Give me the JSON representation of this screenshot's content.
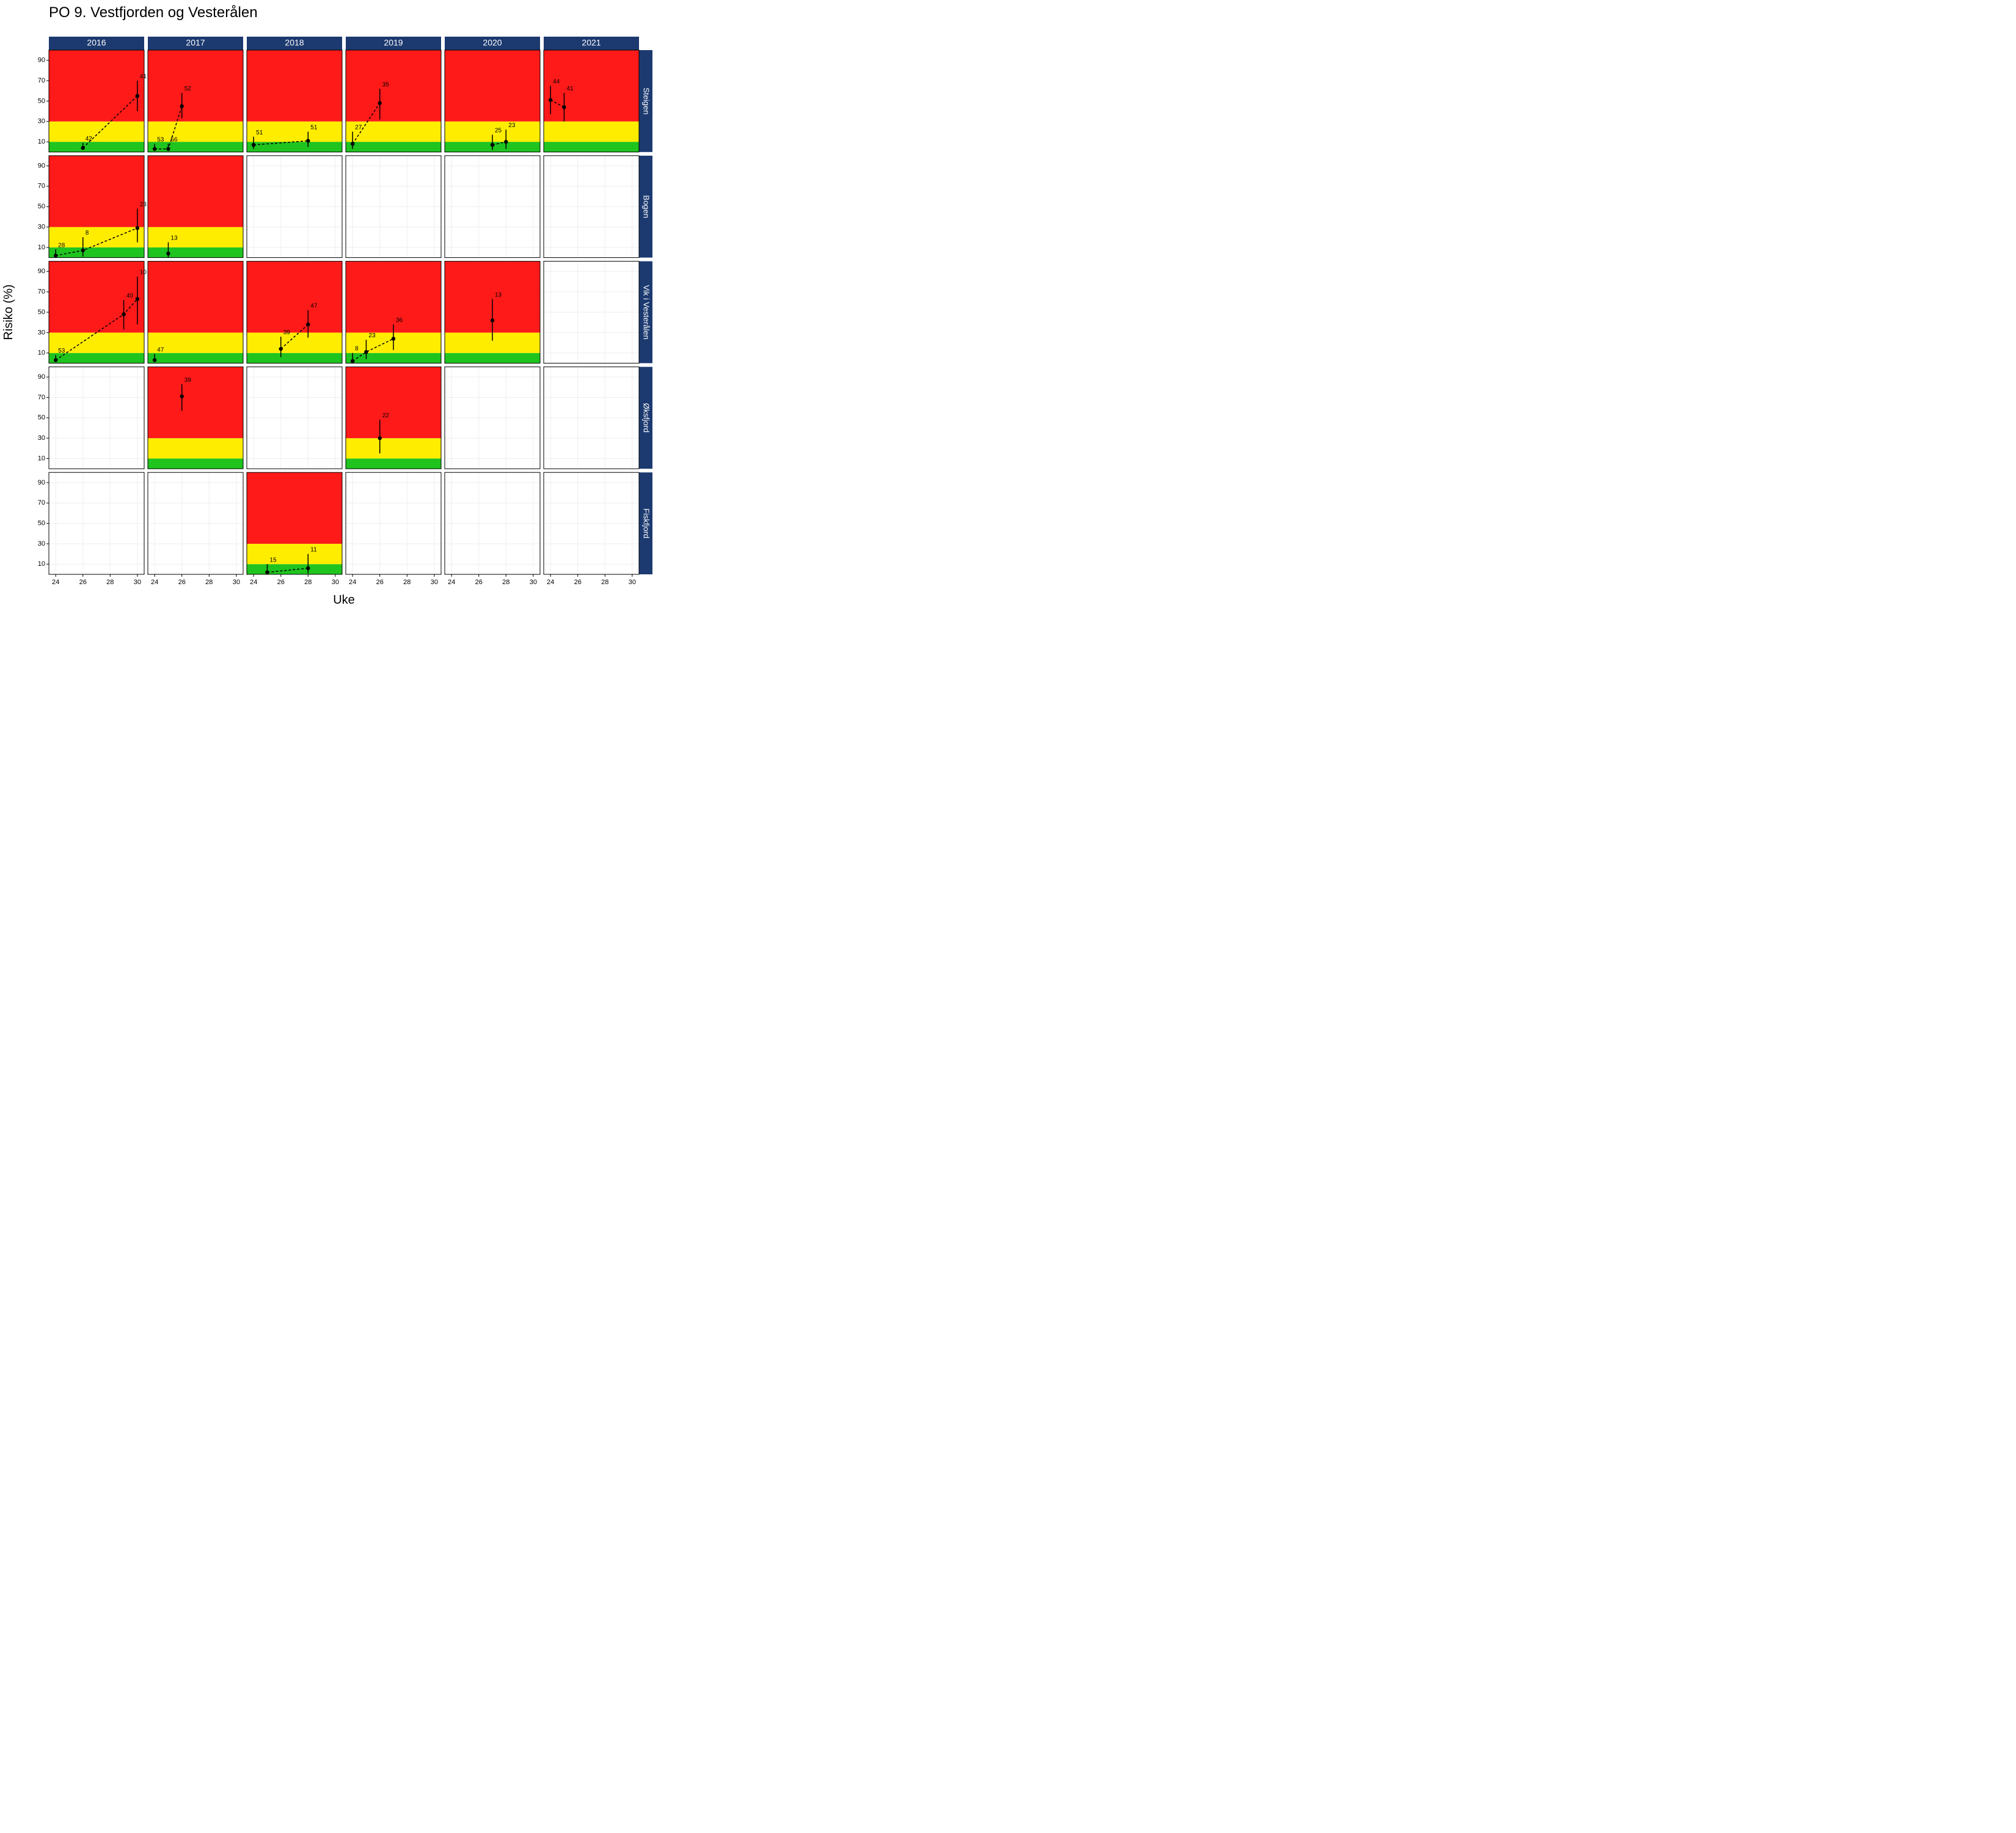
{
  "chart_data": {
    "type": "scatter",
    "title": "PO 9. Vestfjorden og Vesterålen",
    "xlabel": "Uke",
    "ylabel": "Risiko (%)",
    "xlim": [
      23.5,
      30.5
    ],
    "ylim": [
      0,
      100
    ],
    "x_ticks": [
      24,
      26,
      28,
      30
    ],
    "y_ticks": [
      10,
      30,
      50,
      70,
      90
    ],
    "zones": [
      {
        "from": 0,
        "to": 10,
        "color": "green"
      },
      {
        "from": 10,
        "to": 30,
        "color": "yellow"
      },
      {
        "from": 30,
        "to": 100,
        "color": "red"
      }
    ],
    "cols": [
      "2016",
      "2017",
      "2018",
      "2019",
      "2020",
      "2021"
    ],
    "rows": [
      "Steigen",
      "Bogen",
      "Vik i Vesterålen",
      "Øksfjord",
      "Fiskfjord"
    ],
    "panels": [
      {
        "r": 0,
        "c": 0,
        "data": true,
        "pts": [
          {
            "x": 26,
            "y": 4,
            "lo": 2,
            "hi": 9,
            "n": 42
          },
          {
            "x": 30,
            "y": 55,
            "lo": 40,
            "hi": 70,
            "n": 41
          }
        ]
      },
      {
        "r": 0,
        "c": 1,
        "data": true,
        "pts": [
          {
            "x": 24,
            "y": 3,
            "lo": 1,
            "hi": 8,
            "n": 53
          },
          {
            "x": 25,
            "y": 3,
            "lo": 1,
            "hi": 8,
            "n": 56
          },
          {
            "x": 26,
            "y": 45,
            "lo": 33,
            "hi": 58,
            "n": 52
          }
        ]
      },
      {
        "r": 0,
        "c": 2,
        "data": true,
        "pts": [
          {
            "x": 24,
            "y": 7,
            "lo": 3,
            "hi": 15,
            "n": 51
          },
          {
            "x": 28,
            "y": 11,
            "lo": 5,
            "hi": 20,
            "n": 51
          }
        ]
      },
      {
        "r": 0,
        "c": 3,
        "data": true,
        "pts": [
          {
            "x": 24,
            "y": 8,
            "lo": 3,
            "hi": 20,
            "n": 27
          },
          {
            "x": 26,
            "y": 48,
            "lo": 32,
            "hi": 62,
            "n": 35
          }
        ]
      },
      {
        "r": 0,
        "c": 4,
        "data": true,
        "pts": [
          {
            "x": 27,
            "y": 7,
            "lo": 2,
            "hi": 17,
            "n": 25
          },
          {
            "x": 28,
            "y": 10,
            "lo": 3,
            "hi": 22,
            "n": 23
          }
        ]
      },
      {
        "r": 0,
        "c": 5,
        "data": true,
        "pts": [
          {
            "x": 24,
            "y": 51,
            "lo": 37,
            "hi": 65,
            "n": 44
          },
          {
            "x": 25,
            "y": 44,
            "lo": 30,
            "hi": 58,
            "n": 41
          }
        ]
      },
      {
        "r": 1,
        "c": 0,
        "data": true,
        "pts": [
          {
            "x": 24,
            "y": 2,
            "lo": 0,
            "hi": 8,
            "n": 28
          },
          {
            "x": 26,
            "y": 7,
            "lo": 1,
            "hi": 20,
            "n": 8
          },
          {
            "x": 30,
            "y": 29,
            "lo": 15,
            "hi": 48,
            "n": 23
          }
        ]
      },
      {
        "r": 1,
        "c": 1,
        "data": true,
        "pts": [
          {
            "x": 25,
            "y": 4,
            "lo": 0,
            "hi": 15,
            "n": 13
          }
        ]
      },
      {
        "r": 1,
        "c": 2,
        "data": false
      },
      {
        "r": 1,
        "c": 3,
        "data": false
      },
      {
        "r": 1,
        "c": 4,
        "data": false
      },
      {
        "r": 1,
        "c": 5,
        "data": false
      },
      {
        "r": 2,
        "c": 0,
        "data": true,
        "pts": [
          {
            "x": 24,
            "y": 3,
            "lo": 1,
            "hi": 8,
            "n": 53
          },
          {
            "x": 29,
            "y": 48,
            "lo": 33,
            "hi": 62,
            "n": 40
          },
          {
            "x": 30,
            "y": 63,
            "lo": 38,
            "hi": 85,
            "n": 10
          }
        ]
      },
      {
        "r": 2,
        "c": 1,
        "data": true,
        "pts": [
          {
            "x": 24,
            "y": 3,
            "lo": 1,
            "hi": 9,
            "n": 47
          }
        ]
      },
      {
        "r": 2,
        "c": 2,
        "data": true,
        "pts": [
          {
            "x": 26,
            "y": 14,
            "lo": 6,
            "hi": 26,
            "n": 39
          },
          {
            "x": 28,
            "y": 38,
            "lo": 25,
            "hi": 52,
            "n": 47
          }
        ]
      },
      {
        "r": 2,
        "c": 3,
        "data": true,
        "pts": [
          {
            "x": 24,
            "y": 2,
            "lo": 0,
            "hi": 10,
            "n": 8
          },
          {
            "x": 25,
            "y": 11,
            "lo": 4,
            "hi": 23,
            "n": 23
          },
          {
            "x": 27,
            "y": 24,
            "lo": 13,
            "hi": 38,
            "n": 36
          }
        ]
      },
      {
        "r": 2,
        "c": 4,
        "data": true,
        "pts": [
          {
            "x": 27,
            "y": 42,
            "lo": 22,
            "hi": 63,
            "n": 13
          }
        ]
      },
      {
        "r": 2,
        "c": 5,
        "data": false
      },
      {
        "r": 3,
        "c": 0,
        "data": false
      },
      {
        "r": 3,
        "c": 1,
        "data": true,
        "pts": [
          {
            "x": 26,
            "y": 71,
            "lo": 57,
            "hi": 83,
            "n": 39
          }
        ]
      },
      {
        "r": 3,
        "c": 2,
        "data": false
      },
      {
        "r": 3,
        "c": 3,
        "data": true,
        "pts": [
          {
            "x": 26,
            "y": 30,
            "lo": 15,
            "hi": 48,
            "n": 22
          }
        ]
      },
      {
        "r": 3,
        "c": 4,
        "data": false
      },
      {
        "r": 3,
        "c": 5,
        "data": false
      },
      {
        "r": 4,
        "c": 0,
        "data": false
      },
      {
        "r": 4,
        "c": 1,
        "data": false
      },
      {
        "r": 4,
        "c": 2,
        "data": true,
        "pts": [
          {
            "x": 25,
            "y": 2,
            "lo": 0,
            "hi": 10,
            "n": 15
          },
          {
            "x": 28,
            "y": 6,
            "lo": 1,
            "hi": 20,
            "n": 11
          }
        ]
      },
      {
        "r": 4,
        "c": 3,
        "data": false
      },
      {
        "r": 4,
        "c": 4,
        "data": false
      },
      {
        "r": 4,
        "c": 5,
        "data": false
      }
    ]
  }
}
